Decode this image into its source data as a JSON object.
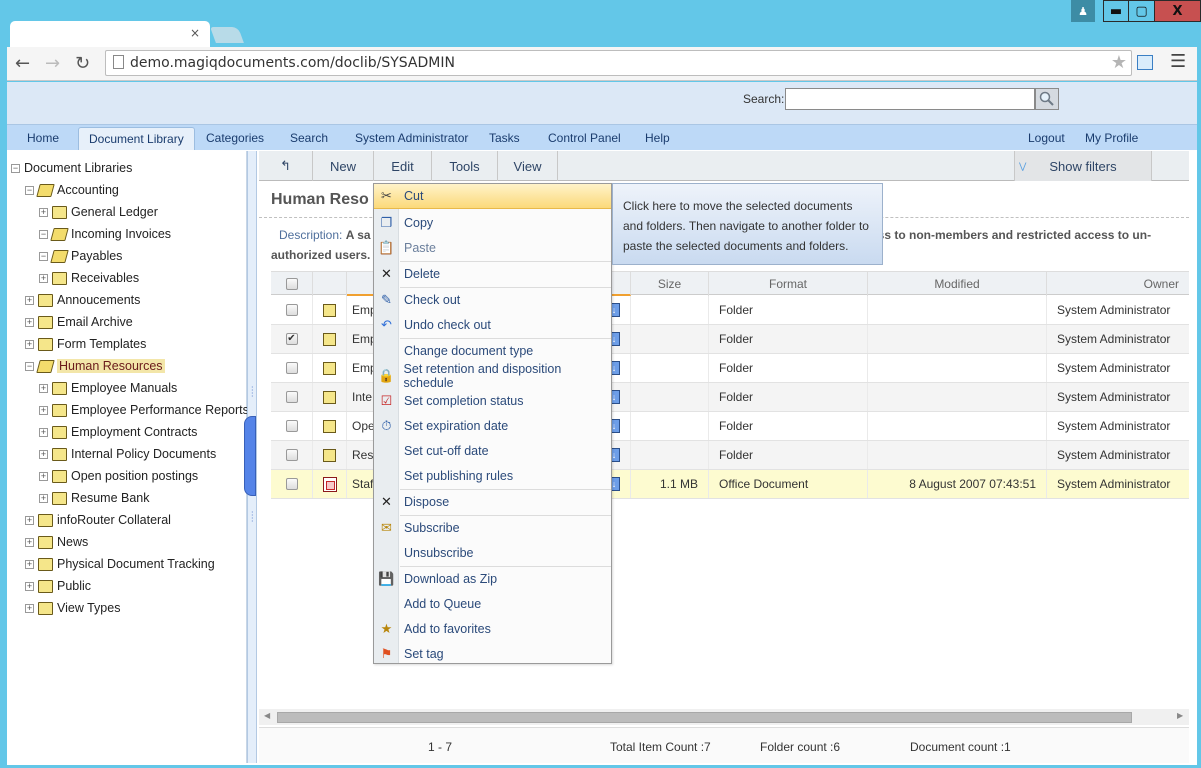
{
  "browser": {
    "url": "demo.magiqdocuments.com/doclib/SYSADMIN",
    "tab_close": "×",
    "window_controls": {
      "user": "user-icon",
      "minimize": "minimize-icon",
      "maximize": "maximize-icon",
      "close": "X"
    }
  },
  "header": {
    "search_label": "Search:",
    "search_value": "",
    "nav": [
      {
        "label": "Home"
      },
      {
        "label": "Document Library",
        "active": true
      },
      {
        "label": "Categories"
      },
      {
        "label": "Search"
      },
      {
        "label": "System Administrator"
      },
      {
        "label": "Tasks"
      },
      {
        "label": "Control Panel"
      },
      {
        "label": "Help"
      }
    ],
    "nav_right": [
      {
        "label": "Logout"
      },
      {
        "label": "My Profile"
      }
    ]
  },
  "tree": {
    "root": "Document Libraries",
    "items": [
      {
        "label": "Accounting",
        "level": 1,
        "expanded": true
      },
      {
        "label": "General Ledger",
        "level": 2,
        "expanded": false
      },
      {
        "label": "Incoming Invoices",
        "level": 2,
        "expanded": true
      },
      {
        "label": "Payables",
        "level": 2,
        "expanded": true
      },
      {
        "label": "Receivables",
        "level": 2,
        "expanded": false
      },
      {
        "label": "Annoucements",
        "level": 1,
        "expanded": false
      },
      {
        "label": "Email Archive",
        "level": 1,
        "expanded": false
      },
      {
        "label": "Form Templates",
        "level": 1,
        "expanded": false
      },
      {
        "label": "Human Resources",
        "level": 1,
        "expanded": true,
        "selected": true
      },
      {
        "label": "Employee Manuals",
        "level": 2,
        "expanded": false
      },
      {
        "label": "Employee Performance Reports",
        "level": 2,
        "expanded": false
      },
      {
        "label": "Employment Contracts",
        "level": 2,
        "expanded": false
      },
      {
        "label": "Internal Policy Documents",
        "level": 2,
        "expanded": false
      },
      {
        "label": "Open position postings",
        "level": 2,
        "expanded": false
      },
      {
        "label": "Resume Bank",
        "level": 2,
        "expanded": false
      },
      {
        "label": "infoRouter Collateral",
        "level": 1,
        "expanded": false
      },
      {
        "label": "News",
        "level": 1,
        "expanded": false
      },
      {
        "label": "Physical Document Tracking",
        "level": 1,
        "expanded": false
      },
      {
        "label": "Public",
        "level": 1,
        "expanded": false
      },
      {
        "label": "View Types",
        "level": 1,
        "expanded": false
      }
    ]
  },
  "commands": {
    "back": "↰",
    "new": "New",
    "edit": "Edit",
    "tools": "Tools",
    "view": "View",
    "show_filters": "Show filters"
  },
  "folder": {
    "title": "Human Reso",
    "description_label": "Description:",
    "description_start": "A sa",
    "description_end": "ess to non-members and restricted access to un-",
    "description_line2": "authorized users."
  },
  "grid": {
    "columns": [
      "",
      "",
      "Size",
      "Format",
      "Modified",
      "Owner"
    ],
    "rows": [
      {
        "name": "Emp",
        "type": "folder",
        "checked": false,
        "size": "",
        "format": "Folder",
        "modified": "",
        "owner": "System Administrator"
      },
      {
        "name": "Emp",
        "type": "folder",
        "checked": true,
        "size": "",
        "format": "Folder",
        "modified": "",
        "owner": "System Administrator"
      },
      {
        "name": "Emp",
        "type": "folder",
        "checked": false,
        "size": "",
        "format": "Folder",
        "modified": "",
        "owner": "System Administrator"
      },
      {
        "name": "Inte",
        "type": "folder",
        "checked": false,
        "size": "",
        "format": "Folder",
        "modified": "",
        "owner": "System Administrator"
      },
      {
        "name": "Ope",
        "type": "folder",
        "checked": false,
        "size": "",
        "format": "Folder",
        "modified": "",
        "owner": "System Administrator"
      },
      {
        "name": "Resu",
        "type": "folder",
        "checked": false,
        "size": "",
        "format": "Folder",
        "modified": "",
        "owner": "System Administrator"
      },
      {
        "name": "Staf",
        "type": "document",
        "checked": false,
        "size": "1.1 MB",
        "format": "Office Document",
        "modified": "8 August 2007 07:43:51",
        "owner": "System Administrator",
        "highlighted": true
      }
    ]
  },
  "footer": {
    "range": "1 - 7",
    "total": "Total Item Count :7",
    "folders": "Folder count :6",
    "documents": "Document count :1"
  },
  "context_menu": {
    "items": [
      {
        "label": "Cut",
        "icon": "scissors-icon",
        "glyph": "✂",
        "hover": true
      },
      {
        "label": "Copy",
        "icon": "copy-icon",
        "glyph": "❐"
      },
      {
        "label": "Paste",
        "icon": "paste-icon",
        "glyph": "📋",
        "dim": true
      },
      {
        "label": "Delete",
        "icon": "delete-x-icon",
        "glyph": "✕"
      },
      {
        "label": "Check out",
        "icon": "check-out-icon",
        "glyph": "✎"
      },
      {
        "label": "Undo check out",
        "icon": "undo-icon",
        "glyph": "↶"
      },
      {
        "label": "Change document type",
        "icon": "",
        "glyph": ""
      },
      {
        "label": "Set retention and disposition schedule",
        "icon": "lock-document-icon",
        "glyph": "🔒"
      },
      {
        "label": "Set completion status",
        "icon": "checkmark-document-icon",
        "glyph": "☑"
      },
      {
        "label": "Set expiration date",
        "icon": "stopwatch-icon",
        "glyph": "⏱"
      },
      {
        "label": "Set cut-off date",
        "icon": "",
        "glyph": ""
      },
      {
        "label": "Set publishing rules",
        "icon": "",
        "glyph": ""
      },
      {
        "label": "Dispose",
        "icon": "dispose-x-icon",
        "glyph": "✕"
      },
      {
        "label": "Subscribe",
        "icon": "subscribe-icon",
        "glyph": "✉"
      },
      {
        "label": "Unsubscribe",
        "icon": "",
        "glyph": ""
      },
      {
        "label": "Download as Zip",
        "icon": "download-zip-icon",
        "glyph": "💾"
      },
      {
        "label": "Add to Queue",
        "icon": "",
        "glyph": ""
      },
      {
        "label": "Add to favorites",
        "icon": "add-favorites-icon",
        "glyph": "★"
      },
      {
        "label": "Set tag",
        "icon": "flag-icon",
        "glyph": "⚑"
      }
    ],
    "tooltip": "Click here to move the selected documents and folders. Then navigate to another folder to paste the selected documents and folders."
  },
  "colors": {
    "titlebar": "#63c7e8",
    "nav_bg": "#bdd9f7",
    "menu_hover": "#fbd97a",
    "highlight_row": "#fdfbd0",
    "selected_tree": "#f3e6a9"
  }
}
